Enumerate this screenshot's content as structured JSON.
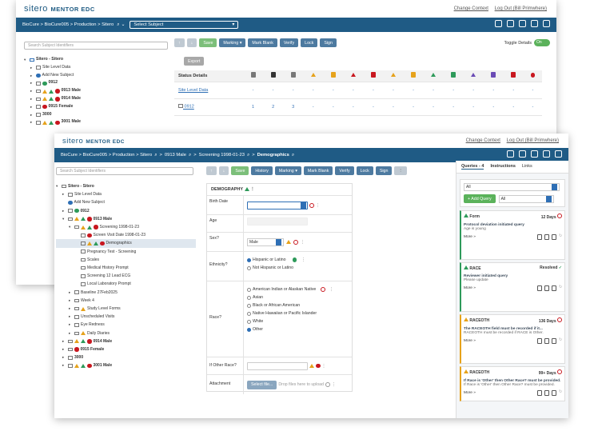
{
  "app": {
    "logo_prefix": "sitero",
    "logo_suffix": "MENTOR EDC",
    "change_context": "Change Context",
    "logout": "Log Out (Bill Primwhere)"
  },
  "back": {
    "breadcrumb": "BioCure > BioCure005 > Production > Sitero",
    "subject_select": "Select Subject",
    "search_placeholder": "Search Subject Identifiers",
    "toolbar": {
      "save": "Save",
      "marking": "Marking",
      "mark_blank": "Mark Blank",
      "verify": "Verify",
      "lock": "Lock",
      "sign": "Sign",
      "toggle_label": "Toggle Details",
      "toggle_state": "On"
    },
    "export": "Export",
    "status_details": "Status Details",
    "rows": [
      {
        "label": "Site Level Data",
        "values": [
          "-",
          "-",
          "-",
          "-",
          "-",
          "-",
          "-",
          "-",
          "-",
          "-",
          "-",
          "-",
          "-",
          "-",
          "-"
        ]
      },
      {
        "label": "0912",
        "values": [
          "1",
          "2",
          "3",
          "-",
          "-",
          "-",
          "-",
          "-",
          "-",
          "-",
          "-",
          "-",
          "-",
          "-",
          "-"
        ]
      }
    ],
    "tree": [
      {
        "label": "Sitero - Sitero",
        "indent": 0
      },
      {
        "label": "Site Level Data",
        "indent": 1
      },
      {
        "label": "Add New Subject",
        "indent": 1
      },
      {
        "label": "0912",
        "indent": 1
      },
      {
        "label": "0913 Male",
        "indent": 1
      },
      {
        "label": "0914 Male",
        "indent": 1
      },
      {
        "label": "0915 Female",
        "indent": 1
      },
      {
        "label": "3000",
        "indent": 1
      },
      {
        "label": "3001 Male",
        "indent": 1
      }
    ]
  },
  "front": {
    "breadcrumb": "BioCure > BioCure005 > Production > Sitero",
    "crumb_subject": "0913 Male",
    "crumb_visit": "Screening 1998-01-23",
    "crumb_form": "Demographics",
    "search_placeholder": "Search Subject Identifiers",
    "toolbar": {
      "save": "Save",
      "history": "History",
      "marking": "Marking",
      "mark_blank": "Mark Blank",
      "verify": "Verify",
      "lock": "Lock",
      "sign": "Sign"
    },
    "tree": [
      "Sitero - Sitero",
      "Site Level Data",
      "Add New Subject",
      "0912",
      "0913 Male",
      "Screening 1998-01-23",
      "Screen Visit Date 1998-01-23",
      "Demographics",
      "Pregnancy Test - Screening",
      "Scales",
      "Medical History Prompt",
      "Screening 12 Lead ECG",
      "Local Laboratory Prompt",
      "Baseline 27Feb2025",
      "Week 4",
      "Study Level Forms",
      "Unscheduled Visits",
      "Eye Redness",
      "Daily Diaries",
      "0914 Male",
      "0915 Female",
      "3000",
      "3001 Male"
    ],
    "form": {
      "title": "DEMOGRAPHY",
      "birth_date": "Birth Date",
      "age": "Age",
      "sex": "Sex?",
      "sex_value": "Male",
      "ethnicity": "Ethnicity?",
      "eth_options": [
        "Hispanic or Latino",
        "Not Hispanic or Latino"
      ],
      "race": "Race?",
      "race_options": [
        "American Indian or Alaskan Native",
        "Asian",
        "Black or African American",
        "Native Hawaiian or Pacific Islander",
        "White",
        "Other"
      ],
      "other_race": "If Other Race?",
      "attachment": "Attachment",
      "select_file": "Select file...",
      "drop_files": "Drop files here to upload"
    },
    "panel": {
      "tabs": [
        "Queries - 4",
        "Instructions",
        "Links"
      ],
      "filter_all": "All",
      "add_query": "+ Add Query",
      "filter_all2": "All",
      "cards": [
        {
          "field": "Form",
          "status": "12 Days",
          "message": "Protocol deviation initiated query",
          "sub": "Age is young",
          "more": "More"
        },
        {
          "field": "RACE",
          "status": "Resolved",
          "message": "Reviewer initiated query",
          "sub": "Please update",
          "more": "More"
        },
        {
          "field": "RACEOTH",
          "status": "136 Days",
          "message": "The RACEOTH field must be recorded if it...",
          "sub": "RACEOTH must be recorded if RACE is Other.",
          "more": "More"
        },
        {
          "field": "RACEOTH",
          "status": "99+ Days",
          "message": "If Race is 'Other' then Other Race? must be provided.",
          "sub": "If Race is 'Other' then Other Race? must be provided.",
          "more": "More"
        }
      ]
    }
  }
}
